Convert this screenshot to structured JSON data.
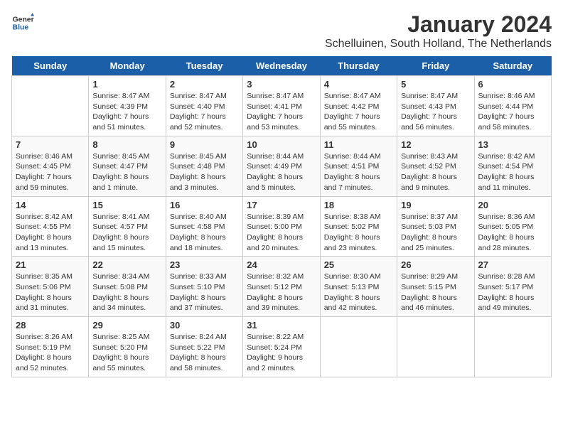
{
  "header": {
    "logo_general": "General",
    "logo_blue": "Blue",
    "title": "January 2024",
    "subtitle": "Schelluinen, South Holland, The Netherlands"
  },
  "weekdays": [
    "Sunday",
    "Monday",
    "Tuesday",
    "Wednesday",
    "Thursday",
    "Friday",
    "Saturday"
  ],
  "weeks": [
    [
      {
        "day": "",
        "info": ""
      },
      {
        "day": "1",
        "info": "Sunrise: 8:47 AM\nSunset: 4:39 PM\nDaylight: 7 hours\nand 51 minutes."
      },
      {
        "day": "2",
        "info": "Sunrise: 8:47 AM\nSunset: 4:40 PM\nDaylight: 7 hours\nand 52 minutes."
      },
      {
        "day": "3",
        "info": "Sunrise: 8:47 AM\nSunset: 4:41 PM\nDaylight: 7 hours\nand 53 minutes."
      },
      {
        "day": "4",
        "info": "Sunrise: 8:47 AM\nSunset: 4:42 PM\nDaylight: 7 hours\nand 55 minutes."
      },
      {
        "day": "5",
        "info": "Sunrise: 8:47 AM\nSunset: 4:43 PM\nDaylight: 7 hours\nand 56 minutes."
      },
      {
        "day": "6",
        "info": "Sunrise: 8:46 AM\nSunset: 4:44 PM\nDaylight: 7 hours\nand 58 minutes."
      }
    ],
    [
      {
        "day": "7",
        "info": "Sunrise: 8:46 AM\nSunset: 4:45 PM\nDaylight: 7 hours\nand 59 minutes."
      },
      {
        "day": "8",
        "info": "Sunrise: 8:45 AM\nSunset: 4:47 PM\nDaylight: 8 hours\nand 1 minute."
      },
      {
        "day": "9",
        "info": "Sunrise: 8:45 AM\nSunset: 4:48 PM\nDaylight: 8 hours\nand 3 minutes."
      },
      {
        "day": "10",
        "info": "Sunrise: 8:44 AM\nSunset: 4:49 PM\nDaylight: 8 hours\nand 5 minutes."
      },
      {
        "day": "11",
        "info": "Sunrise: 8:44 AM\nSunset: 4:51 PM\nDaylight: 8 hours\nand 7 minutes."
      },
      {
        "day": "12",
        "info": "Sunrise: 8:43 AM\nSunset: 4:52 PM\nDaylight: 8 hours\nand 9 minutes."
      },
      {
        "day": "13",
        "info": "Sunrise: 8:42 AM\nSunset: 4:54 PM\nDaylight: 8 hours\nand 11 minutes."
      }
    ],
    [
      {
        "day": "14",
        "info": "Sunrise: 8:42 AM\nSunset: 4:55 PM\nDaylight: 8 hours\nand 13 minutes."
      },
      {
        "day": "15",
        "info": "Sunrise: 8:41 AM\nSunset: 4:57 PM\nDaylight: 8 hours\nand 15 minutes."
      },
      {
        "day": "16",
        "info": "Sunrise: 8:40 AM\nSunset: 4:58 PM\nDaylight: 8 hours\nand 18 minutes."
      },
      {
        "day": "17",
        "info": "Sunrise: 8:39 AM\nSunset: 5:00 PM\nDaylight: 8 hours\nand 20 minutes."
      },
      {
        "day": "18",
        "info": "Sunrise: 8:38 AM\nSunset: 5:02 PM\nDaylight: 8 hours\nand 23 minutes."
      },
      {
        "day": "19",
        "info": "Sunrise: 8:37 AM\nSunset: 5:03 PM\nDaylight: 8 hours\nand 25 minutes."
      },
      {
        "day": "20",
        "info": "Sunrise: 8:36 AM\nSunset: 5:05 PM\nDaylight: 8 hours\nand 28 minutes."
      }
    ],
    [
      {
        "day": "21",
        "info": "Sunrise: 8:35 AM\nSunset: 5:06 PM\nDaylight: 8 hours\nand 31 minutes."
      },
      {
        "day": "22",
        "info": "Sunrise: 8:34 AM\nSunset: 5:08 PM\nDaylight: 8 hours\nand 34 minutes."
      },
      {
        "day": "23",
        "info": "Sunrise: 8:33 AM\nSunset: 5:10 PM\nDaylight: 8 hours\nand 37 minutes."
      },
      {
        "day": "24",
        "info": "Sunrise: 8:32 AM\nSunset: 5:12 PM\nDaylight: 8 hours\nand 39 minutes."
      },
      {
        "day": "25",
        "info": "Sunrise: 8:30 AM\nSunset: 5:13 PM\nDaylight: 8 hours\nand 42 minutes."
      },
      {
        "day": "26",
        "info": "Sunrise: 8:29 AM\nSunset: 5:15 PM\nDaylight: 8 hours\nand 46 minutes."
      },
      {
        "day": "27",
        "info": "Sunrise: 8:28 AM\nSunset: 5:17 PM\nDaylight: 8 hours\nand 49 minutes."
      }
    ],
    [
      {
        "day": "28",
        "info": "Sunrise: 8:26 AM\nSunset: 5:19 PM\nDaylight: 8 hours\nand 52 minutes."
      },
      {
        "day": "29",
        "info": "Sunrise: 8:25 AM\nSunset: 5:20 PM\nDaylight: 8 hours\nand 55 minutes."
      },
      {
        "day": "30",
        "info": "Sunrise: 8:24 AM\nSunset: 5:22 PM\nDaylight: 8 hours\nand 58 minutes."
      },
      {
        "day": "31",
        "info": "Sunrise: 8:22 AM\nSunset: 5:24 PM\nDaylight: 9 hours\nand 2 minutes."
      },
      {
        "day": "",
        "info": ""
      },
      {
        "day": "",
        "info": ""
      },
      {
        "day": "",
        "info": ""
      }
    ]
  ]
}
